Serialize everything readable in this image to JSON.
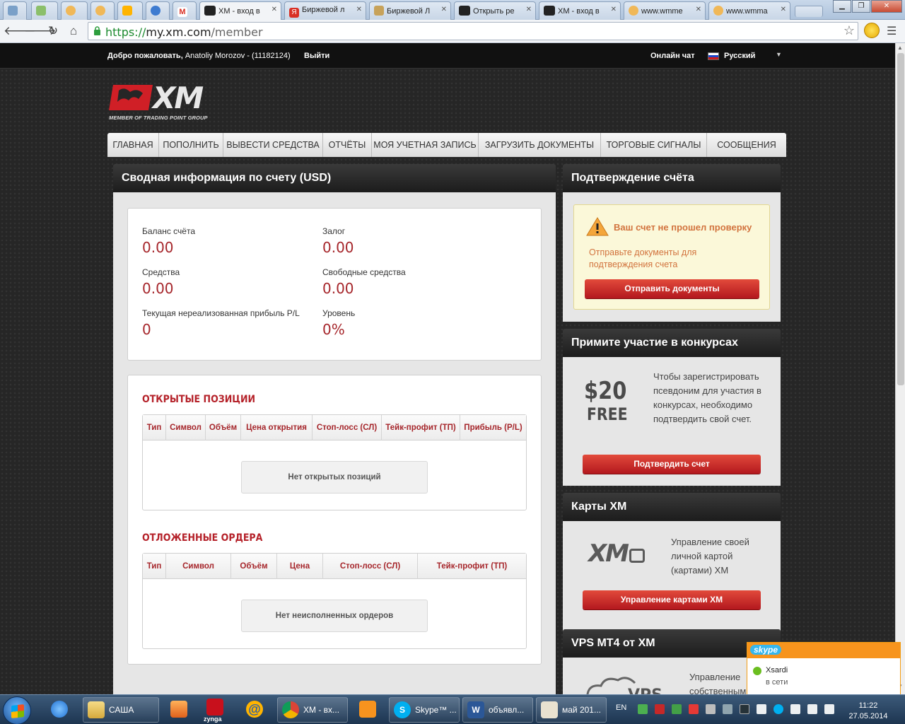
{
  "browser": {
    "tabs": [
      {
        "label": "",
        "icon": "site-icon"
      },
      {
        "label": "",
        "icon": "site-icon"
      },
      {
        "label": "",
        "icon": "site-icon"
      },
      {
        "label": "",
        "icon": "site-icon"
      },
      {
        "label": "",
        "icon": "mail-icon"
      },
      {
        "label": "",
        "icon": "site-icon"
      },
      {
        "label": "",
        "icon": "gmail-icon"
      },
      {
        "label": "XM - вход в",
        "icon": "xm-icon",
        "active": true
      },
      {
        "label": "Биржевой л",
        "icon": "yandex-icon"
      },
      {
        "label": "Биржевой Л",
        "icon": "site-icon"
      },
      {
        "label": "Открыть ре",
        "icon": "xm-icon"
      },
      {
        "label": "XM - вход в",
        "icon": "xm-icon"
      },
      {
        "label": "www.wmme",
        "icon": "site-icon"
      },
      {
        "label": "www.wmma",
        "icon": "site-icon"
      }
    ],
    "url": {
      "scheme": "https://",
      "host": "my.xm.com",
      "path": "/member"
    }
  },
  "topbar": {
    "welcome": "Добро пожаловать,",
    "user": "Anatoliy Morozov - (11182124)",
    "logout": "Выйти",
    "chat": "Онлайн чат",
    "language": "Русский"
  },
  "logo": {
    "text": "XM",
    "tagline": "MEMBER OF TRADING POINT GROUP"
  },
  "nav": {
    "items": [
      "ГЛАВНАЯ",
      "ПОПОЛНИТЬ",
      "ВЫВЕСТИ СРЕДСТВА",
      "ОТЧЁТЫ",
      "МОЯ УЧЕТНАЯ ЗАПИСЬ",
      "ЗАГРУЗИТЬ ДОКУМЕНТЫ",
      "ТОРГОВЫЕ СИГНАЛЫ",
      "СООБЩЕНИЯ"
    ]
  },
  "summary": {
    "title": "Сводная информация по счету (USD)",
    "metrics": [
      {
        "label": "Баланс счёта",
        "value": "0.00"
      },
      {
        "label": "Залог",
        "value": "0.00"
      },
      {
        "label": "Средства",
        "value": "0.00"
      },
      {
        "label": "Свободные средства",
        "value": "0.00"
      },
      {
        "label": "Текущая нереализованная прибыль P/L",
        "value": "0"
      },
      {
        "label": "Уровень",
        "value": "0%"
      }
    ],
    "open_positions": {
      "title": "ОТКРЫТЫЕ ПОЗИЦИИ",
      "columns": [
        "Тип",
        "Символ",
        "Объём",
        "Цена открытия",
        "Стоп-лосс (СЛ)",
        "Тейк-профит (ТП)",
        "Прибыль (P/L)"
      ],
      "empty": "Нет открытых позиций"
    },
    "pending_orders": {
      "title": "ОТЛОЖЕННЫЕ ОРДЕРА",
      "columns": [
        "Тип",
        "Символ",
        "Объём",
        "Цена",
        "Стоп-лосс (СЛ)",
        "Тейк-профит (ТП)"
      ],
      "empty": "Нет неисполненных ордеров"
    }
  },
  "verification": {
    "title": "Подтверждение счёта",
    "warning_title": "Ваш счет не прошел проверку",
    "warning_text": "Отправьте документы для подтверждения счета",
    "button": "Отправить документы"
  },
  "contest": {
    "title": "Примите участие в конкурсах",
    "promo_amount": "$20",
    "promo_word": "FREE",
    "text": "Чтобы зарегистрировать псевдоним для участия в конкурсах, необходимо подтвердить свой счет.",
    "button": "Подтвердить счет"
  },
  "cards": {
    "title": "Карты XM",
    "logo": "XM",
    "text": "Управление своей личной картой (картами) XM",
    "button": "Управление картами XM"
  },
  "vps": {
    "title": "VPS MT4 от XM",
    "text": "Управление собственным"
  },
  "skype_popup": {
    "brand": "skype",
    "name": "Xsardi",
    "status": "в сети"
  },
  "taskbar": {
    "items": [
      {
        "label": "",
        "icon": "ie-icon"
      },
      {
        "label": "САША",
        "icon": "folder-icon"
      },
      {
        "label": "",
        "icon": "media-icon"
      },
      {
        "label": "zynga",
        "icon": "zynga-icon"
      },
      {
        "label": "",
        "icon": "mail-agent-icon"
      },
      {
        "label": "XM - вх...",
        "icon": "chrome-icon"
      },
      {
        "label": "",
        "icon": "odnoklassniki-icon"
      },
      {
        "label": "Skype™ ...",
        "icon": "skype-icon"
      },
      {
        "label": "объявл...",
        "icon": "word-icon"
      },
      {
        "label": "май 201...",
        "icon": "app-icon"
      }
    ],
    "lang": "EN",
    "time": "11:22",
    "date": "27.05.2014"
  },
  "colors": {
    "accent": "#b5222a",
    "warning": "#d2733e",
    "button": "#c8211f"
  }
}
